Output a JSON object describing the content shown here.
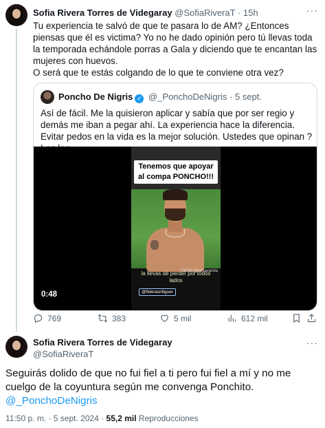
{
  "tweet1": {
    "author_name": "Sofia Rivera Torres de Videgaray",
    "handle": "@SofiaRiveraT",
    "separator": "·",
    "time": "15h",
    "more": "···",
    "text": "Tu experiencia te salvó de que te pasara lo de AM? ¿Entonces piensas que él es victima? Yo no he dado opinión pero tú llevas toda la temporada echándole porras a Gala y diciendo que te encantan las mujeres con huevos.",
    "text2": "O será que te estás colgando de lo que te conviene otra vez?",
    "quote": {
      "author_name": "Poncho De Nigris",
      "verified": "✓",
      "handle": "@_PonchoDeNigris",
      "separator": "·",
      "time": "5 sept.",
      "text": "Así de fácil. Me la quisieron aplicar y sabía que por ser regio y demás me iban a pegar ahí. La experiencia hace la diferencia. Evitar pedos en la vida es la mejor solución. Ustedes que opinan ? Los leo",
      "video": {
        "caption_top": "Tenemos que apoyar al compa PONCHO!!!",
        "caption_bottom": "la llevas de perder por todos lados",
        "watermark": "TikTok @sofiavarela",
        "user_tag": "@fiderasnfiguer",
        "duration": "0:48"
      }
    },
    "actions": {
      "replies": "769",
      "retweets": "383",
      "likes": "5 mil",
      "views": "612 mil"
    },
    "icons": [
      "reply-icon",
      "retweet-icon",
      "like-icon",
      "views-icon",
      "bookmark-icon",
      "share-icon"
    ]
  },
  "tweet2": {
    "author_name": "Sofia Rivera Torres de Videgaray",
    "handle": "@SofiaRiveraT",
    "more": "···",
    "text": "Seguirás dolido de que no fui fiel a ti pero fui fiel a mí y no me cuelgo de la coyuntura según me convenga Ponchito.",
    "mention": "@_PonchoDeNigris",
    "timestamp": "11:50 p. m. · 5 sept. 2024 ·",
    "views_count": "55,2 mil",
    "views_label": "Reproducciones"
  },
  "colors": {
    "text": "#0f1419",
    "secondary": "#536471",
    "accent": "#1d9bf0",
    "border": "#cfd9de"
  }
}
